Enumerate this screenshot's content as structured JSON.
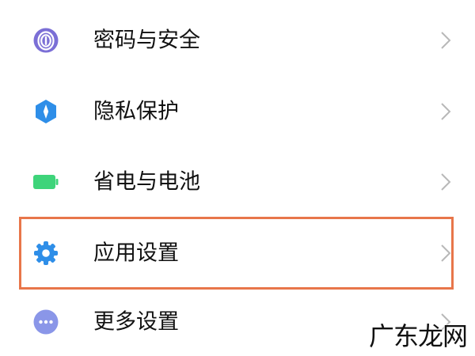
{
  "settings_list": {
    "items": [
      {
        "label": "密码与安全",
        "icon": "fingerprint-icon",
        "color": "#7b6fd6"
      },
      {
        "label": "隐私保护",
        "icon": "privacy-shield-icon",
        "color": "#2e8ee8"
      },
      {
        "label": "省电与电池",
        "icon": "battery-icon",
        "color": "#3ed47a"
      },
      {
        "label": "应用设置",
        "icon": "gear-icon",
        "color": "#2e8ee8"
      },
      {
        "label": "更多设置",
        "icon": "more-dots-icon",
        "color": "#8a96e8"
      }
    ],
    "highlighted_item": "应用设置",
    "highlight_color": "#e8764a"
  },
  "watermark": {
    "text": "广东龙网"
  }
}
